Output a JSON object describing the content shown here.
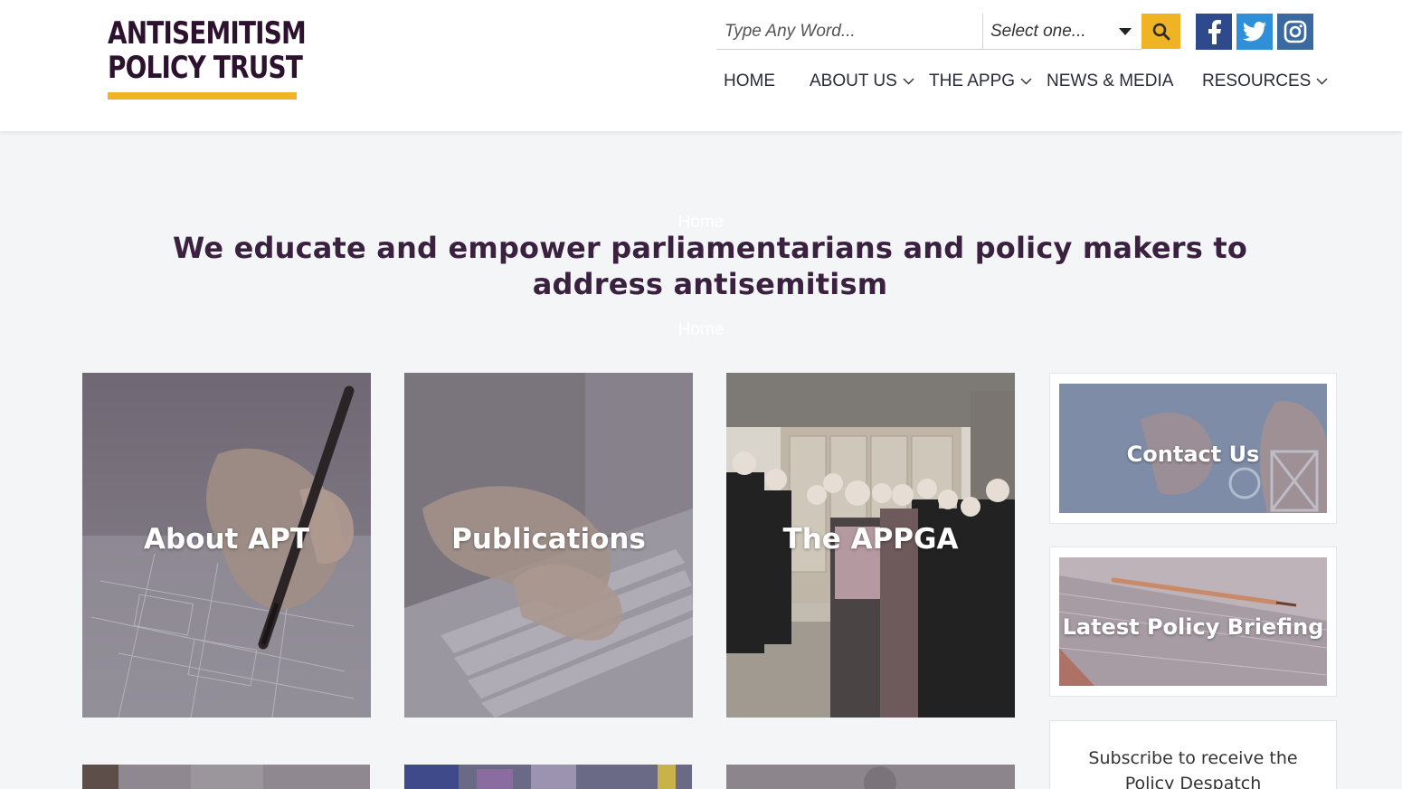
{
  "logo": {
    "line1": "ANTISEMITISM",
    "line2": "POLICY TRUST"
  },
  "search": {
    "placeholder": "Type Any Word...",
    "select_value": "Select one..."
  },
  "nav": {
    "home": "HOME",
    "about": "ABOUT US",
    "appg": "THE APPG",
    "news": "NEWS & MEDIA",
    "resources": "RESOURCES"
  },
  "hero": {
    "breadcrumb_top": "Home",
    "headline": "We educate and empower parliamentarians and policy makers to address antisemitism",
    "breadcrumb_bottom": "Home"
  },
  "cards": [
    {
      "title": "About APT"
    },
    {
      "title": "Publications"
    },
    {
      "title": "The APPGA"
    }
  ],
  "sidebar": {
    "contact": "Contact Us",
    "briefing": "Latest Policy Briefing",
    "subscribe": "Subscribe to receive the Policy Despatch"
  },
  "colors": {
    "brand_purple": "#2d1230",
    "accent_gold": "#f0b323",
    "headline": "#3b2140",
    "background": "#f4f5f7"
  }
}
